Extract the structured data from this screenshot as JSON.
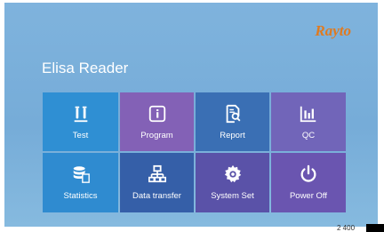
{
  "brand": "Rayto",
  "app_title": "Elisa Reader",
  "tiles": [
    {
      "label": "Test",
      "icon": "test-tubes-icon"
    },
    {
      "label": "Program",
      "icon": "info-icon"
    },
    {
      "label": "Report",
      "icon": "report-search-icon"
    },
    {
      "label": "QC",
      "icon": "bar-chart-icon"
    },
    {
      "label": "Statistics",
      "icon": "database-icon"
    },
    {
      "label": "Data transfer",
      "icon": "network-icon"
    },
    {
      "label": "System Set",
      "icon": "gear-icon"
    },
    {
      "label": "Power Off",
      "icon": "power-icon"
    }
  ],
  "footer_text": "2 400"
}
